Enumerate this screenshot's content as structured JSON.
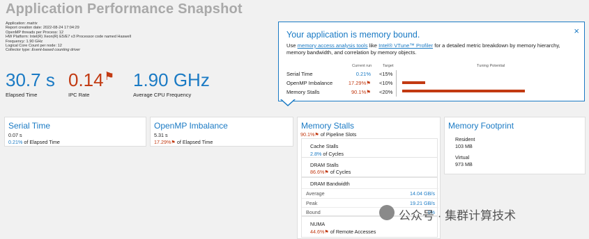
{
  "header": {
    "title": "Application Performance Snapshot",
    "meta": [
      {
        "k": "Application:",
        "v": "matrix"
      },
      {
        "k": "Report creation date:",
        "v": "2022-08-24 17:04:29"
      },
      {
        "k": "OpenMP threads per Process:",
        "v": "12"
      },
      {
        "k": "HW Platform:",
        "v": "Intel(R) Xeon(R) E5/E7 v3 Processor code named Haswell"
      },
      {
        "k": "Frequency:",
        "v": "1.90 GHz"
      },
      {
        "k": "Logical Core Count per node:",
        "v": "12"
      },
      {
        "k": "Collector type:",
        "v": "Event-based counting driver"
      }
    ]
  },
  "summary": {
    "elapsed_value": "30.7 s",
    "elapsed_label": "Elapsed Time",
    "ipc_value": "0.14",
    "ipc_label": "IPC Rate",
    "freq_value": "1.90 GHz",
    "freq_label": "Average CPU Frequency"
  },
  "tooltip": {
    "title": "Your application is memory bound.",
    "desc_pre": "Use",
    "desc_link1": "memory access analysis tools",
    "desc_mid": "like",
    "desc_link2": "Intel® VTune™ Profiler",
    "desc_post": "for a detailed metric breakdown by memory hierarchy, memory bandwidth, and correlation by memory objects.",
    "col_current": "Current run",
    "col_target": "Target",
    "col_tuning": "Tuning Potential",
    "close": "×",
    "metrics": [
      {
        "name": "Serial Time",
        "current": "0.21%",
        "target": "<15%",
        "potential": 0
      },
      {
        "name": "OpenMP Imbalance",
        "current": "17.29%",
        "target": "<10%",
        "potential": 0.17
      },
      {
        "name": "Memory Stalls",
        "current": "90.1%",
        "target": "<20%",
        "potential": 0.9
      }
    ],
    "colors": {
      "accent": "#1a7ac4",
      "bad": "#c23a12"
    }
  },
  "cards": {
    "serial": {
      "title": "Serial Time",
      "v1": "0.07 s",
      "v2": "0.21%",
      "v2_label": "of Elapsed Time"
    },
    "omp": {
      "title": "OpenMP Imbalance",
      "v1": "5.31 s",
      "v2": "17.29%",
      "v2_label": "of Elapsed Time"
    },
    "mem": {
      "title": "Memory Stalls",
      "v1": "90.1%",
      "v1_label": "of Pipeline Slots",
      "cache_title": "Cache Stalls",
      "cache_val": "2.8%",
      "cache_label": "of Cycles",
      "dram_title": "DRAM Stalls",
      "dram_val": "86.6%",
      "dram_label": "of Cycles",
      "bw_title": "DRAM Bandwidth",
      "bw_rows": [
        {
          "k": "Average",
          "v": "14.04 GB/s"
        },
        {
          "k": "Peak",
          "v": "19.21 GB/s"
        },
        {
          "k": "Bound",
          "v": "0%"
        }
      ],
      "numa_title": "NUMA",
      "numa_val": "44.6%",
      "numa_label": "of Remote Accesses"
    },
    "foot": {
      "title": "Memory Footprint",
      "res_label": "Resident",
      "res_val": "103 MB",
      "virt_label": "Virtual",
      "virt_val": "973 MB"
    }
  },
  "watermark": "公众号 · 集群计算技术"
}
